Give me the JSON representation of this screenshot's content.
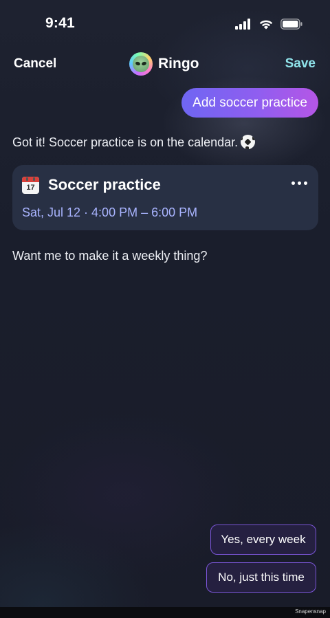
{
  "status_bar": {
    "time": "9:41",
    "icons": [
      "signal-icon",
      "wifi-icon",
      "battery-icon"
    ]
  },
  "nav": {
    "cancel_label": "Cancel",
    "title": "Ringo",
    "save_label": "Save",
    "avatar_icon": "alien-avatar-icon"
  },
  "colors": {
    "background": "#1a1e2c",
    "save_accent": "#8fe3ea",
    "bubble_gradient_start": "#6f66f2",
    "bubble_gradient_end": "#b556e6",
    "event_time": "#a9b4ff",
    "quick_reply_border": "#7b55d8"
  },
  "chat": {
    "user_message": "Add soccer practice",
    "assistant_message_1": "Got it! Soccer practice is on the calendar.",
    "assistant_message_1_emoji": "soccer-ball-icon",
    "assistant_message_2": "Want me to make it a weekly thing?"
  },
  "event_card": {
    "icon": "calendar-icon",
    "calendar_icon_day": "17",
    "title": "Soccer practice",
    "time": "Sat, Jul 12 · 4:00 PM – 6:00 PM",
    "more_icon": "more-horizontal-icon"
  },
  "quick_replies": {
    "yes_label": "Yes, every week",
    "no_label": "No, just this time"
  },
  "footer": {
    "credit": "Snapensnap"
  }
}
